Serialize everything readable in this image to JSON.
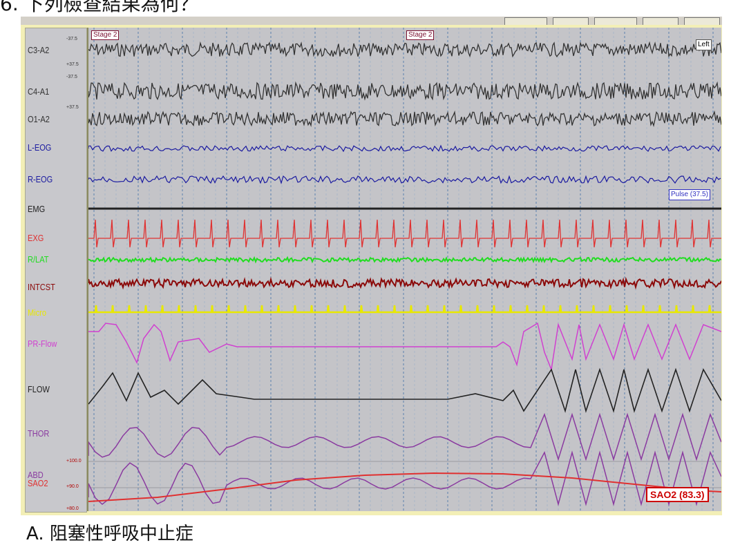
{
  "question": "6. 下列檢查結果為何？",
  "answer": "A. 阻塞性呼吸中止症",
  "markers": {
    "stage_1": "Stage 2",
    "stage_2": "Stage 2"
  },
  "scales": {
    "c3_top": "-37.5",
    "c3_bot": "+37.5",
    "c4_top": "-37.5",
    "o1_top": "+37.5",
    "abd_top": "+100.0",
    "abd_mid": "+90.0",
    "abd_bot": "+80.0"
  },
  "side_boxes": {
    "left": "Left",
    "pulse": "Pulse (37.5)",
    "sao2": "SAO2 (83.3)"
  },
  "channels": [
    {
      "label": "C3-A2",
      "color": "#333333"
    },
    {
      "label": "C4-A1",
      "color": "#333333"
    },
    {
      "label": "O1-A2",
      "color": "#333333"
    },
    {
      "label": "L-EOG",
      "color": "#1a1aa0"
    },
    {
      "label": "R-EOG",
      "color": "#1a1aa0"
    },
    {
      "label": "EMG",
      "color": "#222222"
    },
    {
      "label": "EXG",
      "color": "#e03030"
    },
    {
      "label": "R/LAT",
      "color": "#20dd20"
    },
    {
      "label": "INTCST",
      "color": "#8b0a0a"
    },
    {
      "label": "Micro",
      "color": "#e8e800"
    },
    {
      "label": "PR-Flow",
      "color": "#d040d0"
    },
    {
      "label": "FLOW",
      "color": "#222222"
    },
    {
      "label": "THOR",
      "color": "#8a3aa0"
    },
    {
      "label": "ABD",
      "color": "#8a3aa0"
    },
    {
      "label": "SAO2",
      "color": "#e03030"
    }
  ]
}
